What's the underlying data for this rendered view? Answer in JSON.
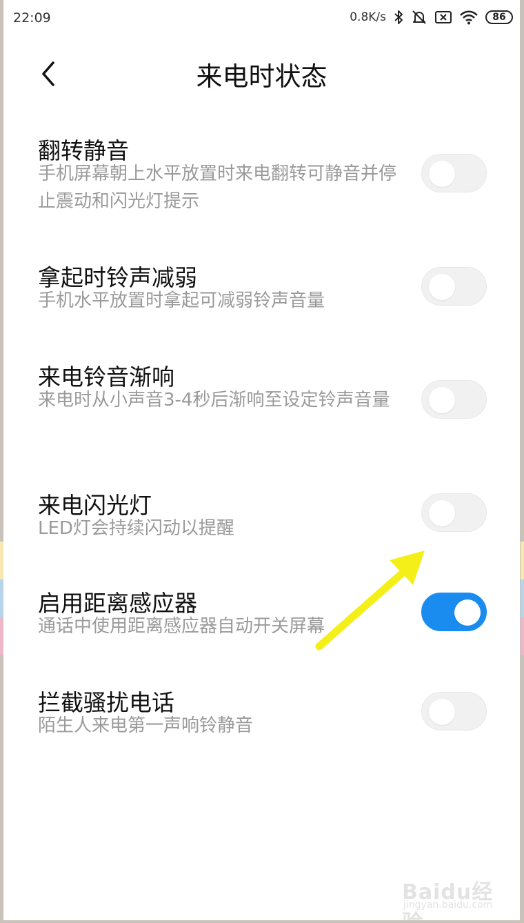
{
  "status_bar": {
    "time": "22:09",
    "net_speed": "0.8K/s",
    "battery": "86",
    "icons": [
      "bluetooth-icon",
      "bell-muted-icon",
      "no-sim-icon",
      "wifi-icon",
      "battery-icon"
    ]
  },
  "header": {
    "title": "来电时状态",
    "back_icon": "chevron-left-icon"
  },
  "settings": [
    {
      "title": "翻转静音",
      "desc": "手机屏幕朝上水平放置时来电翻转可静音并停止震动和闪光灯提示",
      "enabled": false
    },
    {
      "title": "拿起时铃声减弱",
      "desc": "手机水平放置时拿起可减弱铃声音量",
      "enabled": false
    },
    {
      "title": "来电铃音渐响",
      "desc": "来电时从小声音3-4秒后渐响至设定铃声音量",
      "enabled": false
    },
    {
      "title": "来电闪光灯",
      "desc": "LED灯会持续闪动以提醒",
      "enabled": false
    },
    {
      "title": "启用距离感应器",
      "desc": "通话中使用距离感应器自动开关屏幕",
      "enabled": true
    },
    {
      "title": "拦截骚扰电话",
      "desc": "陌生人来电第一声响铃静音",
      "enabled": false
    }
  ],
  "colors": {
    "accent": "#1a8cf0",
    "arrow": "#f5ef19",
    "toggle_off": "#f1f1f1",
    "desc_text": "#9a9a9a"
  },
  "watermark": {
    "main": "Baidu经验",
    "sub": "jingyan.baidu.com"
  }
}
